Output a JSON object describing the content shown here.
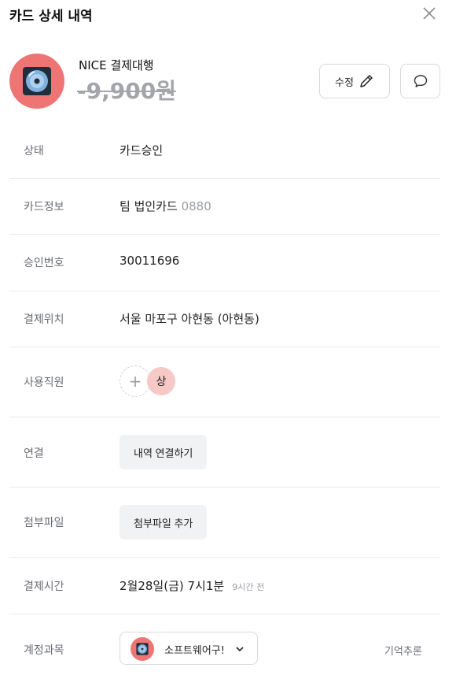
{
  "header": {
    "title": "카드 상세 내역",
    "close_icon": "close-icon"
  },
  "summary": {
    "merchant": "NICE 결제대행",
    "amount": "-9,900원",
    "logo_icon": "disc-icon",
    "logo_color": "#ef7575",
    "edit_label": "수정",
    "edit_icon": "pencil-icon",
    "comment_icon": "speech-bubble-icon"
  },
  "rows": {
    "status": {
      "label": "상태",
      "value": "카드승인"
    },
    "card": {
      "label": "카드정보",
      "value": "팀 법인카드",
      "number": "0880"
    },
    "approval": {
      "label": "승인번호",
      "value": "30011696"
    },
    "location": {
      "label": "결제위치",
      "value": "서울 마포구 아현동 (아현동)"
    },
    "employee": {
      "label": "사용직원",
      "add_icon": "plus-icon",
      "avatar_text": "상"
    },
    "link": {
      "label": "연결",
      "button": "내역 연결하기"
    },
    "attachment": {
      "label": "첨부파일",
      "button": "첨부파일 추가"
    },
    "time": {
      "label": "결제시간",
      "value": "2월28일(금) 7시1분",
      "relative": "9시간 전"
    },
    "account": {
      "label": "계정과목",
      "selected": "소프트웨어구!",
      "memory": "기억추론"
    }
  }
}
